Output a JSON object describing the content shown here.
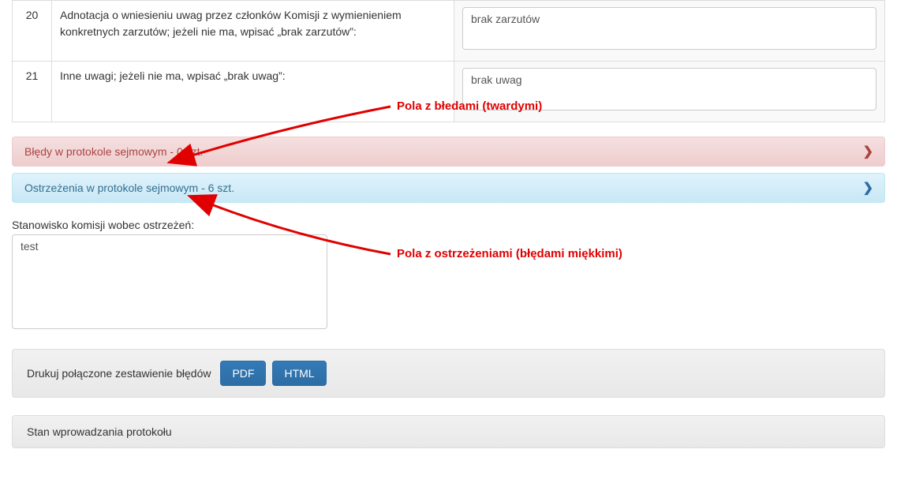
{
  "rows": [
    {
      "num": "20",
      "label": "Adnotacja o wniesieniu uwag przez członków Komisji z wymienieniem konkretnych zarzutów; jeżeli nie ma, wpisać „brak zarzutów”:",
      "value": "brak zarzutów"
    },
    {
      "num": "21",
      "label": "Inne uwagi; jeżeli nie ma, wpisać „brak uwag”:",
      "value": "brak uwag"
    }
  ],
  "panels": {
    "errors_title": "Błędy w protokole sejmowym - 0 szt.",
    "warnings_title": "Ostrzeżenia w protokole sejmowym - 6 szt."
  },
  "annotations": {
    "hard": "Pola z błedami (twardymi)",
    "soft": "Pola z ostrzeżeniami (błędami miękkimi)"
  },
  "stance": {
    "label": "Stanowisko komisji wobec ostrzeżeń:",
    "value": "test"
  },
  "print_row": {
    "label": "Drukuj połączone zestawienie błędów",
    "pdf": "PDF",
    "html": "HTML"
  },
  "status_panel": {
    "title": "Stan wprowadzania protokołu"
  }
}
